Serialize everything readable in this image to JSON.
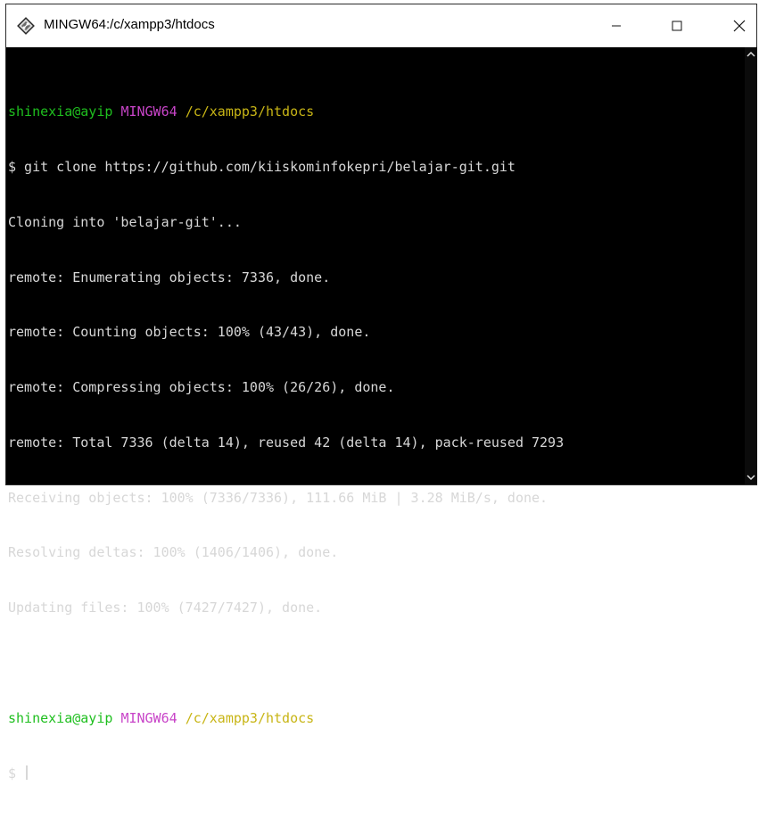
{
  "window": {
    "title": "MINGW64:/c/xampp3/htdocs",
    "controls": {
      "minimize": "minimize-icon",
      "maximize": "maximize-icon",
      "close": "close-icon"
    }
  },
  "colors": {
    "user": "#1fbf1f",
    "system": "#c844c8",
    "path": "#c8b516",
    "text": "#d7d7d7",
    "background": "#000000"
  },
  "terminal": {
    "prompt1": {
      "user": "shinexia@ayip",
      "system": "MINGW64",
      "path": "/c/xampp3/htdocs"
    },
    "command": "$ git clone https://github.com/kiiskominfokepri/belajar-git.git",
    "output": [
      "Cloning into 'belajar-git'...",
      "remote: Enumerating objects: 7336, done.",
      "remote: Counting objects: 100% (43/43), done.",
      "remote: Compressing objects: 100% (26/26), done.",
      "remote: Total 7336 (delta 14), reused 42 (delta 14), pack-reused 7293",
      "Receiving objects: 100% (7336/7336), 111.66 MiB | 3.28 MiB/s, done.",
      "Resolving deltas: 100% (1406/1406), done.",
      "Updating files: 100% (7427/7427), done."
    ],
    "prompt2": {
      "user": "shinexia@ayip",
      "system": "MINGW64",
      "path": "/c/xampp3/htdocs"
    },
    "current_input": "$ "
  }
}
